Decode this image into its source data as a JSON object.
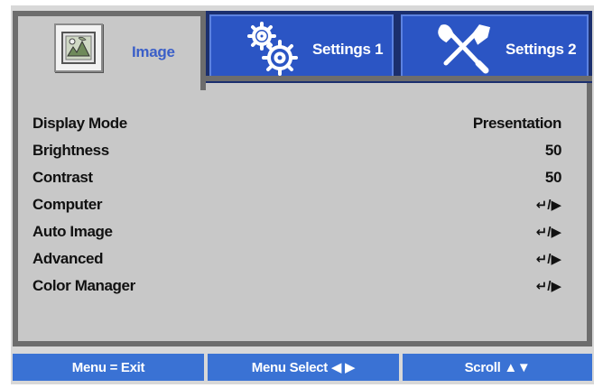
{
  "tabs": [
    {
      "label": "Image",
      "icon": "image-icon",
      "active": true
    },
    {
      "label": "Settings 1",
      "icon": "gears-icon",
      "active": false
    },
    {
      "label": "Settings 2",
      "icon": "tools-icon",
      "active": false
    }
  ],
  "menu": [
    {
      "label": "Display Mode",
      "value": "Presentation"
    },
    {
      "label": "Brightness",
      "value": "50"
    },
    {
      "label": "Contrast",
      "value": "50"
    },
    {
      "label": "Computer",
      "value": "↵/▶"
    },
    {
      "label": "Auto Image",
      "value": "↵/▶"
    },
    {
      "label": "Advanced",
      "value": "↵/▶"
    },
    {
      "label": "Color Manager",
      "value": "↵/▶"
    }
  ],
  "footer": {
    "exit": "Menu = Exit",
    "select": "Menu Select ◀ ▶",
    "scroll": "Scroll ▲▼"
  },
  "colors": {
    "tab_blue": "#2b55c4",
    "footer_blue": "#3a72d4",
    "panel_gray": "#c8c8c8",
    "active_label": "#3b5fc8"
  }
}
